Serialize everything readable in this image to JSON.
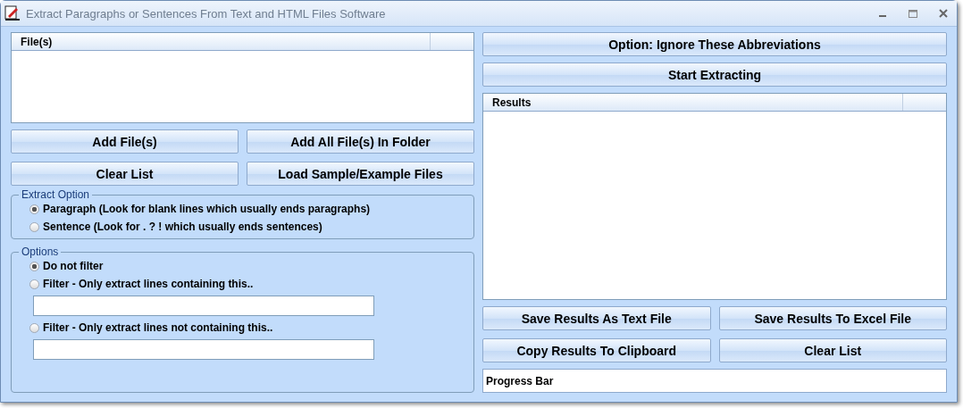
{
  "window": {
    "title": "Extract Paragraphs or Sentences From Text and HTML Files Software"
  },
  "files_list": {
    "columns": [
      "File(s)"
    ]
  },
  "file_buttons": [
    "Add File(s)",
    "Add All File(s) In Folder",
    "Clear List",
    "Load Sample/Example Files"
  ],
  "extract_option": {
    "title": "Extract Option",
    "items": [
      {
        "kind": "radio",
        "label": "Paragraph (Look for blank lines which usually ends paragraphs)",
        "selected": true
      },
      {
        "kind": "radio",
        "label": "Sentence (Look for . ? ! which usually ends sentences)",
        "selected": false
      }
    ]
  },
  "options": {
    "title": "Options",
    "items": [
      {
        "kind": "radio",
        "label": "Do not filter",
        "selected": true
      },
      {
        "kind": "radio",
        "label": "Filter - Only extract lines containing this..",
        "selected": false
      },
      {
        "kind": "field"
      },
      {
        "kind": "radio",
        "label": "Filter - Only extract lines not containing this..",
        "selected": false
      },
      {
        "kind": "field"
      }
    ]
  },
  "top_buttons": [
    "Option: Ignore These Abbreviations",
    "Start Extracting"
  ],
  "results_list": {
    "columns": [
      "Results"
    ]
  },
  "result_buttons": [
    "Save Results As Text File",
    "Save Results To Excel File",
    "Copy Results To Clipboard",
    "Clear List"
  ],
  "progress_bar": {
    "label": "Progress Bar"
  }
}
